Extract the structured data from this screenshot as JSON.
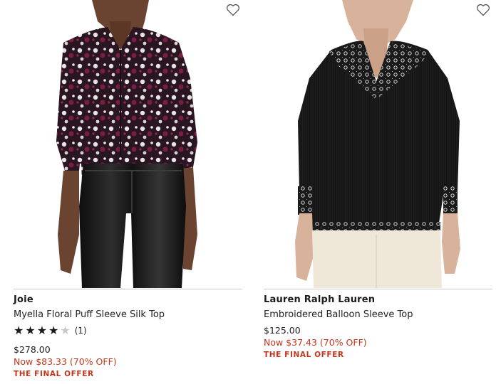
{
  "products": [
    {
      "brand": "Joie",
      "title": "Myella Floral Puff Sleeve Silk Top",
      "rating": {
        "stars": 4,
        "max": 5,
        "count": "(1)"
      },
      "price": "$278.00",
      "sale": "Now $83.33 (70% OFF)",
      "offer": "THE FINAL OFFER",
      "icon": "heart-outline-icon"
    },
    {
      "brand": "Lauren Ralph Lauren",
      "title": "Embroidered Balloon Sleeve Top",
      "price": "$125.00",
      "sale": "Now $37.43 (70% OFF)",
      "offer": "THE FINAL OFFER",
      "icon": "heart-outline-icon"
    }
  ],
  "colors": {
    "sale": "#c4361c",
    "text": "#222222",
    "divider": "#c9c9c9"
  }
}
